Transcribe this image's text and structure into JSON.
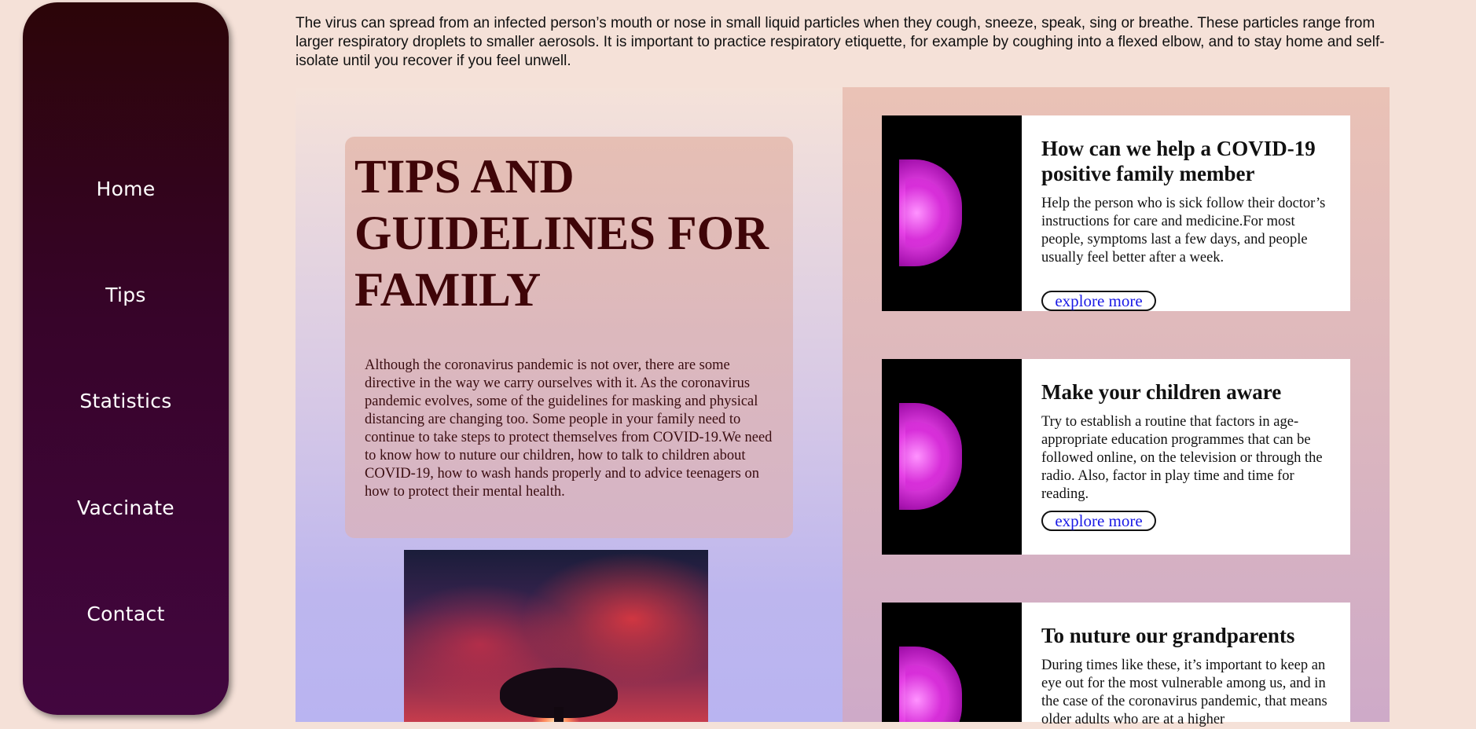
{
  "nav": {
    "items": [
      {
        "label": "Home"
      },
      {
        "label": "Tips"
      },
      {
        "label": "Statistics"
      },
      {
        "label": "Vaccinate"
      },
      {
        "label": "Contact"
      }
    ]
  },
  "intro": {
    "text": "The virus can spread from an infected person’s mouth or nose in small liquid particles when they cough, sneeze, speak, sing or breathe. These particles range from larger respiratory droplets to smaller aerosols. It is important to practice respiratory etiquette, for example by coughing into a flexed elbow, and to stay home and self-isolate until you recover if you feel unwell."
  },
  "tips": {
    "title": "TIPS AND GUIDELINES FOR FAMILY",
    "text": "Although the coronavirus pandemic is not over, there are some directive in the way we carry ourselves with it. As the coronavirus pandemic evolves, some of the guidelines for masking and physical distancing are changing too. Some people in your family need to continue to take steps to protect themselves from COVID-19.We need to know how to nuture our children, how to talk to children about COVID-19, how to wash hands properly and to advice teenagers on how to protect their mental health."
  },
  "cards": [
    {
      "title": "How can we help a COVID-19 positive family member",
      "text": "Help the person who is sick follow their doctor’s instructions for care and medicine.For most people, symptoms last a few days, and people usually feel better after a week.",
      "button": "explore more"
    },
    {
      "title": "Make your children aware",
      "text": "Try to establish a routine that factors in age-appropriate education programmes that can be followed online, on the television or through the radio. Also, factor in play time and time for reading.",
      "button": "explore more"
    },
    {
      "title": "To nuture our grandparents",
      "text": "During times like these, it’s important to keep an eye out for the most vulnerable among us, and in the case of the coronavirus pandemic, that means older adults who are at a higher"
    }
  ],
  "colors": {
    "page_bg": "#f5e1d8",
    "sidebar_top": "#2c0508",
    "sidebar_bottom": "#42063f",
    "title_color": "#3f0508",
    "link_color": "#1a1ae6"
  },
  "icons": {
    "card_image": "purple-flower-image",
    "tree_image": "tree-sunset-image"
  }
}
